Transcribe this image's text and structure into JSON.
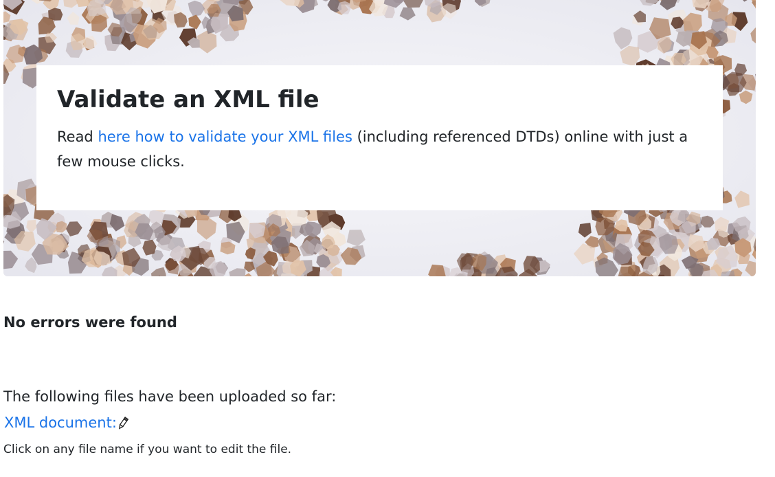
{
  "hero": {
    "title": "Validate an XML file",
    "intro_prefix": "Read ",
    "intro_link": "here how to validate your XML files",
    "intro_suffix": " (including referenced DTDs) online with just a few mouse clicks."
  },
  "result": {
    "status": "No errors were found"
  },
  "uploads": {
    "intro": "The following files have been uploaded so far:",
    "files": [
      {
        "label": "XML document:",
        "icon": "pencil-icon"
      }
    ],
    "hint": "Click on any file name if you want to edit the file."
  },
  "colors": {
    "link": "#1a73e8",
    "text": "#212529",
    "hero_background": "#eeeef3"
  }
}
